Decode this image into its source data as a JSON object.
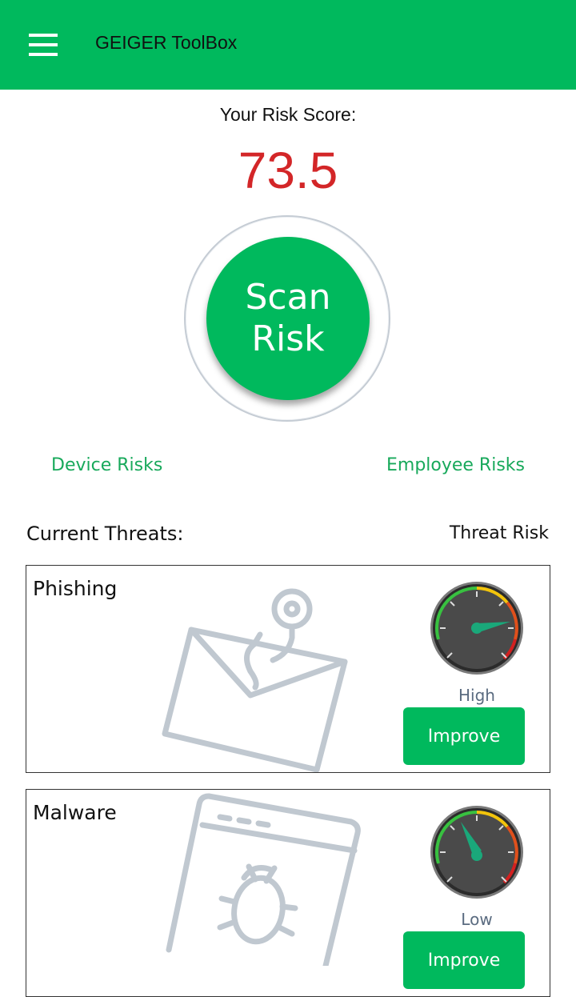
{
  "appbar": {
    "title": "GEIGER ToolBox",
    "menu_icon": "hamburger-menu-icon",
    "color": "#00b95d"
  },
  "risk": {
    "label": "Your Risk Score:",
    "score": "73.5",
    "score_color": "#d32628"
  },
  "scan": {
    "line1": "Scan",
    "line2": "Risk"
  },
  "links": {
    "device": "Device Risks",
    "employee": "Employee Risks"
  },
  "threats": {
    "title": "Current Threats:",
    "risk_header": "Threat Risk",
    "items": [
      {
        "name": "Phishing",
        "level": "High",
        "button": "Improve",
        "icon": "phishing-envelope-hook-icon"
      },
      {
        "name": "Malware",
        "level": "Low",
        "button": "Improve",
        "icon": "malware-bug-icon"
      }
    ]
  }
}
